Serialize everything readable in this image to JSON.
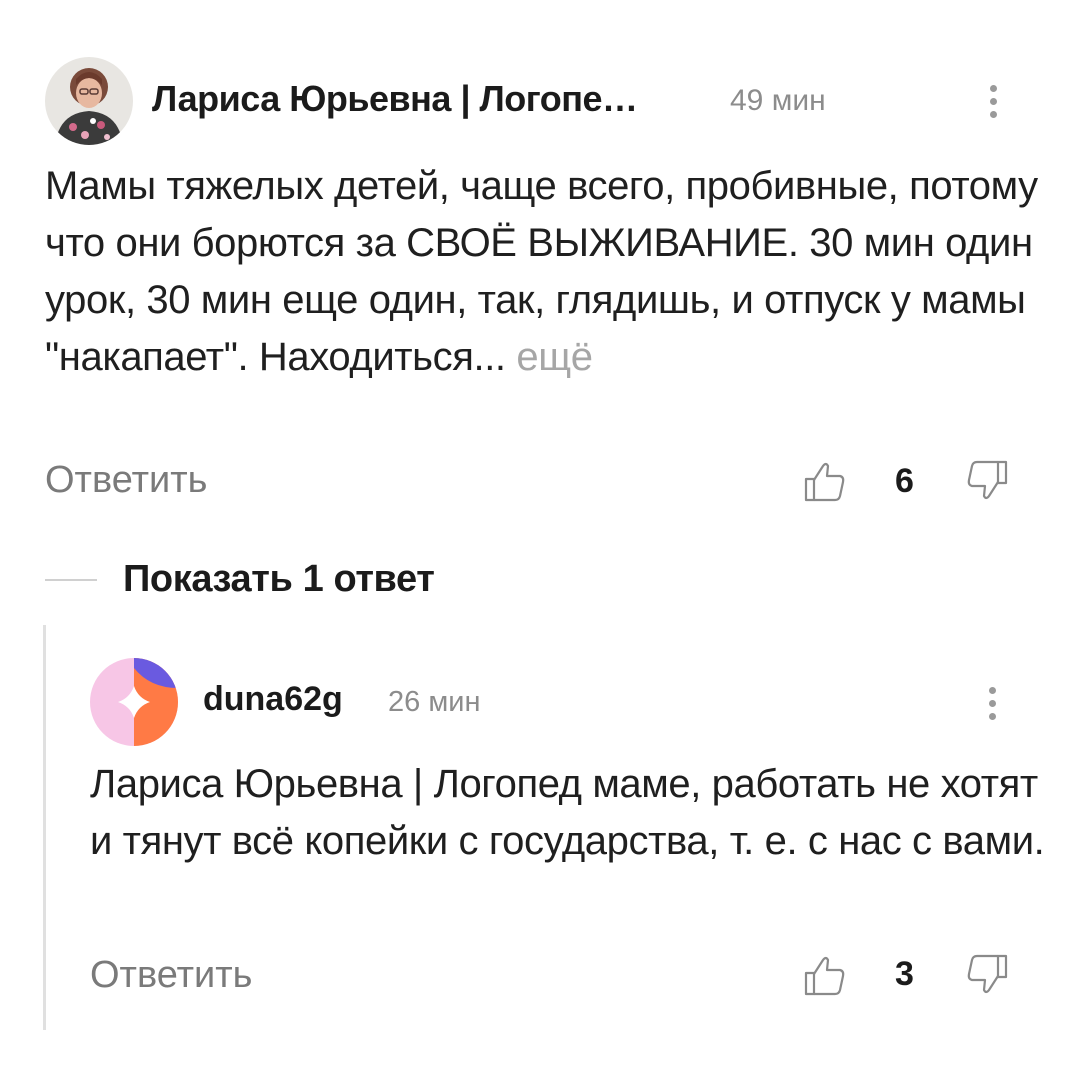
{
  "comment": {
    "author": "Лариса Юрьевна | Логопе…",
    "time": "49 мин",
    "body": "Мамы тяжелых детей, чаще всего, пробивные, потому что они борются за СВОЁ ВЫЖИВАНИЕ. 30 мин один урок, 30 мин еще один, так, глядишь, и отпуск у мамы \"накапает\". Находиться...",
    "more_label": "ещё",
    "reply_label": "Ответить",
    "likes": "6",
    "avatar_icon": "user-photo-avatar"
  },
  "show_replies_label": "Показать 1 ответ",
  "reply": {
    "author": "duna62g",
    "time": "26 мин",
    "body": "Лариса Юрьевна | Логопед маме, работать не хотят и тянут всё копейки с государства, т. е. с нас с вами.",
    "reply_label": "Ответить",
    "likes": "3",
    "avatar_icon": "default-generated-avatar",
    "avatar_colors": [
      "#f7c6e6",
      "#ff7a45",
      "#6a5ae0"
    ]
  },
  "icons": {
    "like": "thumb-up-icon",
    "dislike": "thumb-down-icon",
    "menu": "more-vertical-icon"
  }
}
